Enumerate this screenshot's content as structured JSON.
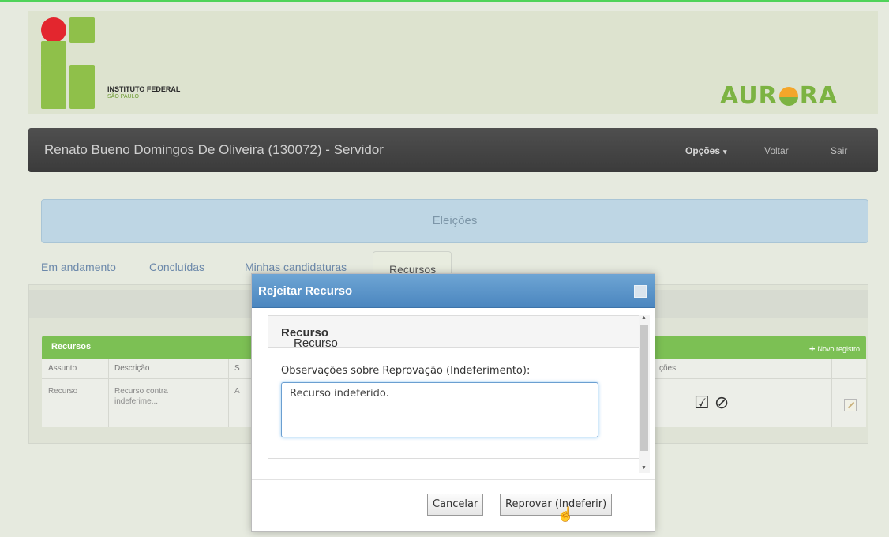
{
  "logo": {
    "title": "INSTITUTO FEDERAL",
    "subtitle": "SÃO PAULO"
  },
  "brand": {
    "name_left": "AUR",
    "name_right": "RA"
  },
  "navbar": {
    "user": "Renato Bueno Domingos De Oliveira (130072) - Servidor",
    "options": "Opções",
    "back": "Voltar",
    "logout": "Sair"
  },
  "elections": {
    "title": "Eleições"
  },
  "tabs": [
    "Em andamento",
    "Concluídas",
    "Minhas candidaturas",
    "Recursos"
  ],
  "recursos": {
    "title": "Recursos",
    "new_record": "Novo registro",
    "columns": [
      "Assunto",
      "Descrição",
      "S",
      "ções"
    ],
    "rows": [
      {
        "assunto": "Recurso",
        "descricao_1": "Recurso contra",
        "descricao_2": "indeferime...",
        "s": "A"
      }
    ]
  },
  "modal": {
    "title": "Rejeitar Recurso",
    "heading_prefix": "Recurso",
    "heading_bold": "Recurso",
    "field_label": "Observações sobre Reprovação (Indeferimento):",
    "field_value": "Recurso indeferido.",
    "cancel": "Cancelar",
    "confirm": "Reprovar (Indeferir)"
  },
  "colors": {
    "navbar": "#444444",
    "accent_green": "#7cc054",
    "modal_header": "#4b86bf",
    "brand_green": "#7cb342"
  }
}
